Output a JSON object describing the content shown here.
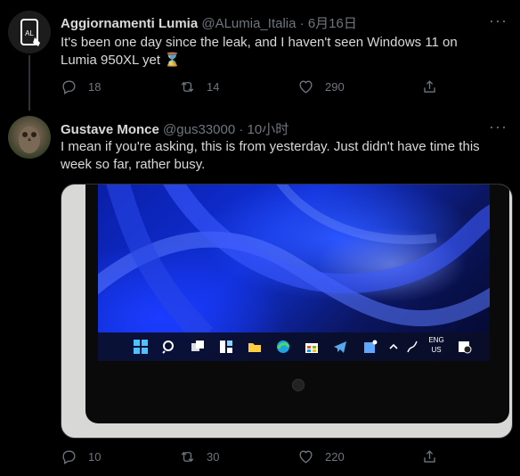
{
  "tweets": [
    {
      "name": "Aggiornamenti Lumia",
      "handle": "@ALumia_Italia",
      "time": "6月16日",
      "text": "It's been one day since the leak, and I haven't seen Windows 11 on Lumia 950XL yet ⌛",
      "replies": "18",
      "retweets": "14",
      "likes": "290"
    },
    {
      "name": "Gustave Monce",
      "handle": "@gus33000",
      "time": "10小时",
      "text": "I mean if you're asking, this is from yesterday. Just didn't have time this week so far, rather busy.",
      "replies": "10",
      "retweets": "30",
      "likes": "220"
    }
  ],
  "media": {
    "taskbar_lang_1": "ENG",
    "taskbar_lang_2": "US"
  },
  "colors": {
    "background": "#000000",
    "text": "#d9d9d9",
    "muted": "#6e767d",
    "accent_blue": "#1d9bf0"
  }
}
